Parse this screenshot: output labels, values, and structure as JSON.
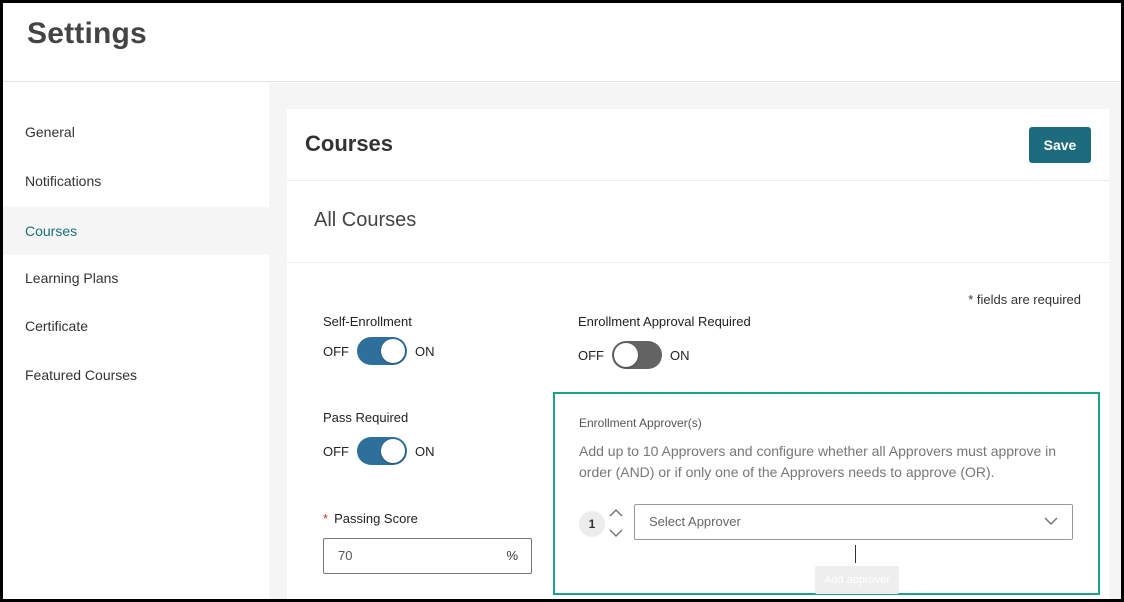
{
  "header": {
    "title": "Settings"
  },
  "sidebar": {
    "items": [
      {
        "label": "General"
      },
      {
        "label": "Notifications"
      },
      {
        "label": "Courses"
      },
      {
        "label": "Learning Plans"
      },
      {
        "label": "Certificate"
      },
      {
        "label": "Featured Courses"
      }
    ],
    "active": "Courses"
  },
  "card": {
    "title": "Courses",
    "save_label": "Save",
    "section_title": "All Courses",
    "required_note": "* fields are required"
  },
  "self_enrollment": {
    "label": "Self-Enrollment",
    "off": "OFF",
    "on": "ON",
    "state": "on"
  },
  "enrollment_approval": {
    "label": "Enrollment Approval Required",
    "off": "OFF",
    "on": "ON",
    "state": "off"
  },
  "pass_required": {
    "label": "Pass Required",
    "off": "OFF",
    "on": "ON",
    "state": "on"
  },
  "passing_score": {
    "required_mark": "*",
    "label": "Passing Score",
    "value": "70",
    "unit": "%"
  },
  "approvers": {
    "label": "Enrollment Approver(s)",
    "description": "Add up to 10 Approvers and configure whether all Approvers must approve in order (AND) or if only one of the Approvers needs to approve (OR).",
    "order": "1",
    "select_placeholder": "Select Approver",
    "add_label": "Add approver"
  },
  "colors": {
    "accent": "#1d6c7e",
    "active_nav": "#1a6f7e",
    "toggle_on": "#2e6f9c",
    "toggle_off": "#636363",
    "highlight_border": "#1aa38a"
  }
}
